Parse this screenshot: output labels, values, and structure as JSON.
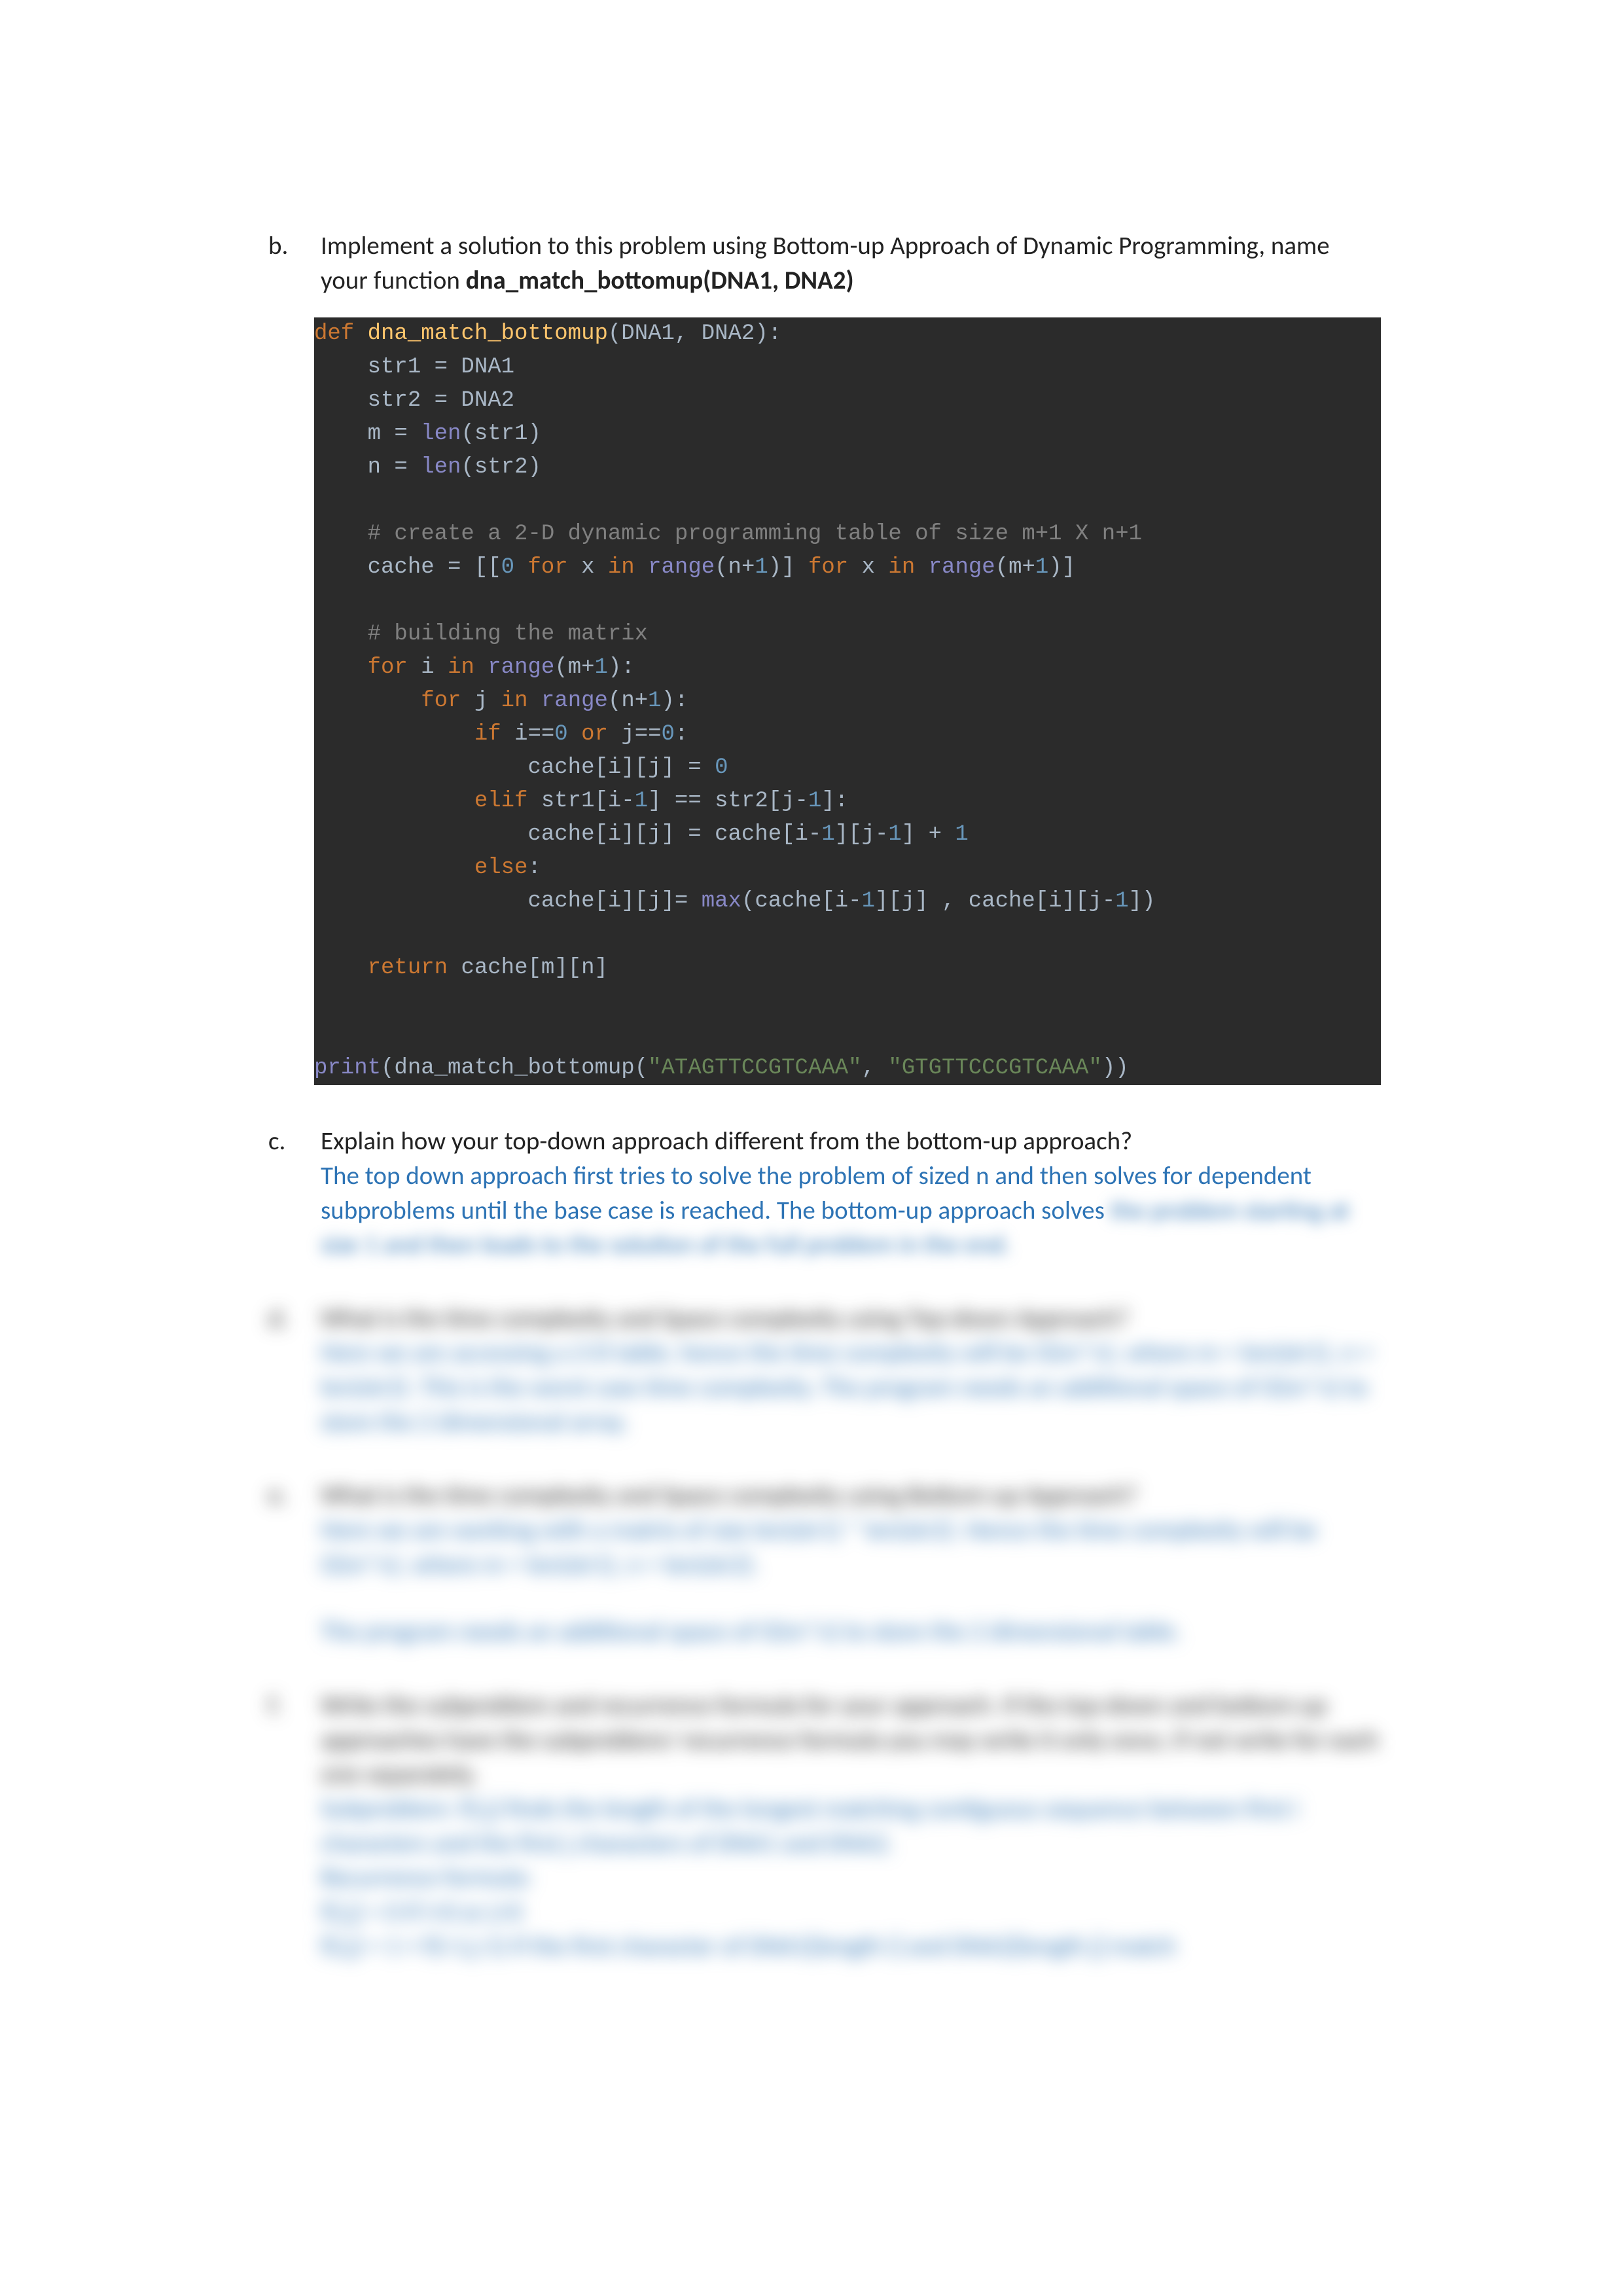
{
  "items": {
    "b": {
      "marker": "b.",
      "prompt_pre": "Implement a solution to this problem using Bottom-up Approach of Dynamic Programming, name your function ",
      "func_name": "dna_match_bottomup(DNA1, DNA2)"
    },
    "c": {
      "marker": "c.",
      "question": "Explain how your top-down approach different from the bottom-up approach?",
      "answer_visible": "The top down approach first tries to solve the problem of sized n and then solves for dependent subproblems until the base case is reached. The bottom-up approach solves",
      "answer_blur": "the problem starting at size 1 and then leads to the solution of the full problem in the end."
    },
    "d": {
      "marker": "d.",
      "question_blur": "What is the time complexity and Space complexity using Top-down Approach?",
      "answer_blur": "Here we are accessing a 2-D table, hence the time complexity will be O(m*n), where m = len(str1), n = len(str2). This is the worst case time complexity. The program needs an additional space of O(m*n) to store the 2 dimensional array."
    },
    "e": {
      "marker": "e.",
      "question_blur": "What is the time complexity and Space complexity using Bottom-up Approach?",
      "answer_blur_1": "Here we are working with a matrix of size len(str1) * len(str2). Hence the time complexity will be O(m*n), where m = len(str1), n = len(str2).",
      "answer_blur_2": "The program needs an additional space of O(m*n) to store the 2 dimensional table."
    },
    "f": {
      "marker": "f.",
      "question_blur": "Write the subproblem and recurrence formula for your approach. If the top-down and bottom-up approaches have the subproblem/ recurrence formula you may write it only once, if not write for each one separately.",
      "answer_blur": "Subproblem: f(i,j) finds the length of the longest matching contiguous sequence between first i characters and the first j characters of DNA1 and DNA2.\nRecurrence formula:\nf(i,j) = 0 if i=0 or j=0\nf(i,j) = 1 + f(i-1,j-1) if the first character of DNA1[length i] and DNA2[length j] match"
    }
  },
  "code": {
    "kw_def": "def",
    "fn_name": "dna_match_bottomup",
    "params": "(DNA1, DNA2):",
    "l2": "    str1 = DNA1",
    "l3": "    str2 = DNA2",
    "l4a": "    m = ",
    "len": "len",
    "l4b": "(str1)",
    "l5a": "    n = ",
    "l5b": "(str2)",
    "c1": "    # create a 2-D dynamic programming table of size m+1 X n+1",
    "l7a": "    cache = [[",
    "zero": "0",
    "for": " for ",
    "in": " in ",
    "range": "range",
    "l7b": "(n+",
    "one": "1",
    "l7c": ")] ",
    "l7d": "(m+",
    "l7e": ")]",
    "c2": "    # building the matrix",
    "l9a": "    ",
    "l9b": "for ",
    "l9c": "i ",
    "l9d": "in ",
    "l9e": "(m+",
    "l9f": "):",
    "l10a": "        ",
    "l10b": "j ",
    "l10c": "(n+",
    "if": "if ",
    "l11a": "            ",
    "l11b": "i==",
    "or": " or ",
    "l11c": "j==",
    "colon": ":",
    "l12": "                cache[i][j] = ",
    "elif": "elif ",
    "l13a": "            ",
    "l13b": "str1[i-",
    "l13c": "] == str2[j-",
    "l13d": "]:",
    "l14a": "                cache[i][j] = cache[i-",
    "l14b": "][j-",
    "l14c": "] + ",
    "else": "else",
    "l15a": "            ",
    "l16a": "                cache[i][j]= ",
    "max": "max",
    "l16b": "(cache[i-",
    "l16c": "][j] , cache[i][j-",
    "l16d": "])",
    "return": "return ",
    "l17": "    ",
    "l17b": "cache[m][n]",
    "print": "print",
    "l19a": "(dna_match_bottomup(",
    "s1": "\"ATAGTTCCGTCAAA\"",
    "l19b": ", ",
    "s2": "\"GTGTTCCCGTCAAA\"",
    "l19c": "))"
  },
  "chart_data": null
}
